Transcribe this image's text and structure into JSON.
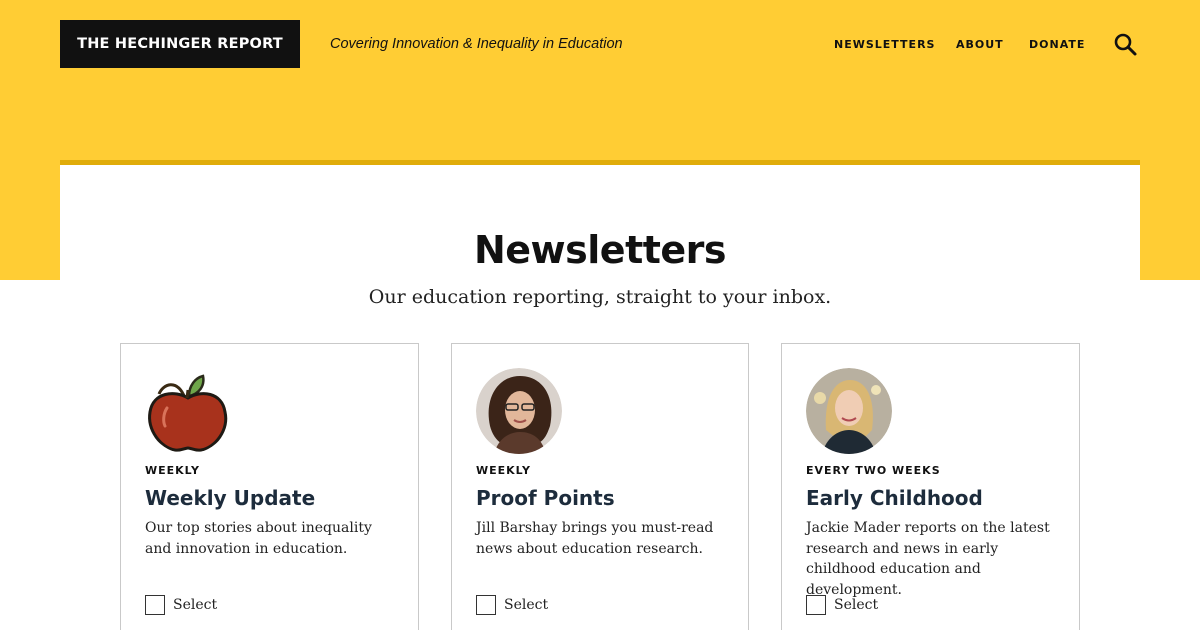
{
  "header": {
    "logo_text": "THE HECHINGER REPORT",
    "tagline": "Covering Innovation & Inequality in Education",
    "nav": [
      "NEWSLETTERS",
      "ABOUT",
      "DONATE"
    ],
    "search_icon": "search-icon"
  },
  "colors": {
    "brand_yellow": "#ffcd34",
    "rule_gold": "#e0ac0a",
    "logo_bg": "#111111",
    "title_navy": "#1d2c3c"
  },
  "main": {
    "title": "Newsletters",
    "subtitle": "Our education reporting, straight to your inbox."
  },
  "cards": [
    {
      "image": "apple-icon",
      "frequency": "WEEKLY",
      "title": "Weekly Update",
      "description": "Our top stories about inequality and innovation in education.",
      "select_label": "Select"
    },
    {
      "image": "author-photo-jill-barshay",
      "frequency": "WEEKLY",
      "title": "Proof Points",
      "description": "Jill Barshay brings you must-read news about education research.",
      "select_label": "Select"
    },
    {
      "image": "author-photo-jackie-mader",
      "frequency": "EVERY TWO WEEKS",
      "title": "Early Childhood",
      "description": "Jackie Mader reports on the latest research and news in early childhood education and development.",
      "select_label": "Select"
    }
  ]
}
